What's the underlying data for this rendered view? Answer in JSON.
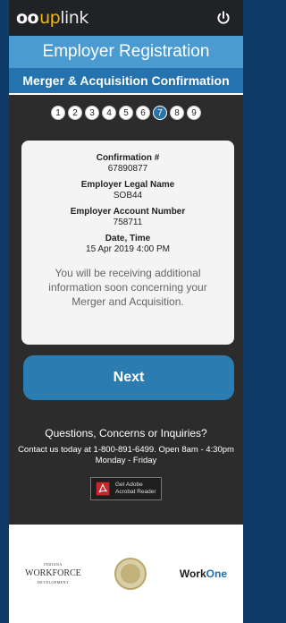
{
  "header": {
    "logo_prefix": "oo",
    "logo_up": "up",
    "logo_link": "link",
    "power_icon": "power-icon"
  },
  "page": {
    "title": "Employer Registration",
    "subtitle": "Merger & Acquisition Confirmation"
  },
  "stepper": {
    "steps": [
      "1",
      "2",
      "3",
      "4",
      "5",
      "6",
      "7",
      "8",
      "9"
    ],
    "active_step": "7"
  },
  "confirmation": {
    "confirmation_label": "Confirmation #",
    "confirmation_value": "67890877",
    "legal_name_label": "Employer Legal Name",
    "legal_name_value": "SOB44",
    "account_label": "Employer Account Number",
    "account_value": "758711",
    "datetime_label": "Date, Time",
    "datetime_value": "15 Apr 2019 4:00 PM",
    "note": "You will be receiving additional information soon concerning your Merger and Acquisition."
  },
  "actions": {
    "next_label": "Next"
  },
  "contact": {
    "question": "Questions, Concerns or Inquiries?",
    "contact_line": "Contact us today at 1-800-891-6499. Open 8am - 4:30pm Monday - Friday"
  },
  "acrobat": {
    "line1": "Get Adobe",
    "line2": "Acrobat Reader"
  },
  "footer": {
    "workforce_top": "INDIANA",
    "workforce_main": "WORKFORCE",
    "workforce_bottom": "DEVELOPMENT",
    "workone_work": "Work",
    "workone_one": "One"
  },
  "colors": {
    "title_band": "#4a9bd1",
    "subtitle_band": "#2473ae",
    "active_step": "#2a73a8",
    "next_button": "#2b7cb0"
  }
}
